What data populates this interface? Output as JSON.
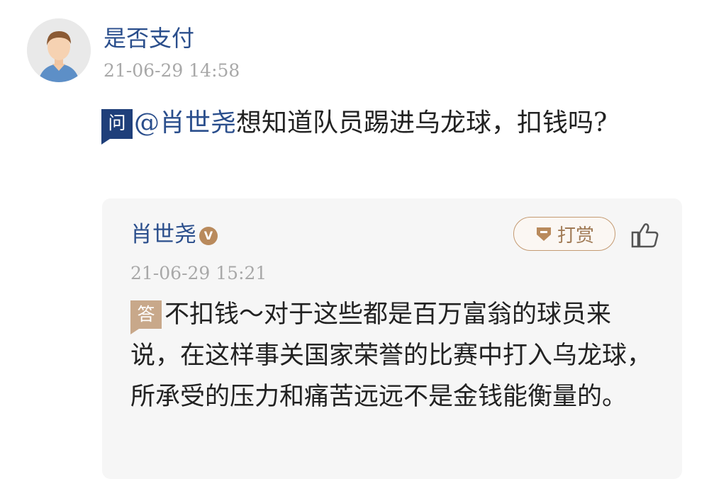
{
  "question_post": {
    "user_name": "是否支付",
    "time": "21-06-29 14:58",
    "badge": "问",
    "mention": "@肖世尧",
    "text": "想知道队员踢进乌龙球，扣钱吗?"
  },
  "answer": {
    "name": "肖世尧",
    "verified_badge": "V",
    "reward_label": "打赏",
    "time": "21-06-29 15:21",
    "badge": "答",
    "text": "不扣钱～对于这些都是百万富翁的球员来说，在这样事关国家荣誉的比赛中打入乌龙球，所承受的压力和痛苦远远不是金钱能衡量的。"
  },
  "icons": {
    "avatar": "default-user-avatar-icon",
    "verified": "verified-v-icon",
    "reward": "gem-icon",
    "like": "thumbs-up-icon"
  },
  "colors": {
    "link_blue": "#2a4e8c",
    "question_badge": "#1f3f7a",
    "answer_badge": "#c8a88a",
    "reward_accent": "#c49a72",
    "time_gray": "#a8a8a8",
    "card_bg": "#f6f6f6"
  }
}
